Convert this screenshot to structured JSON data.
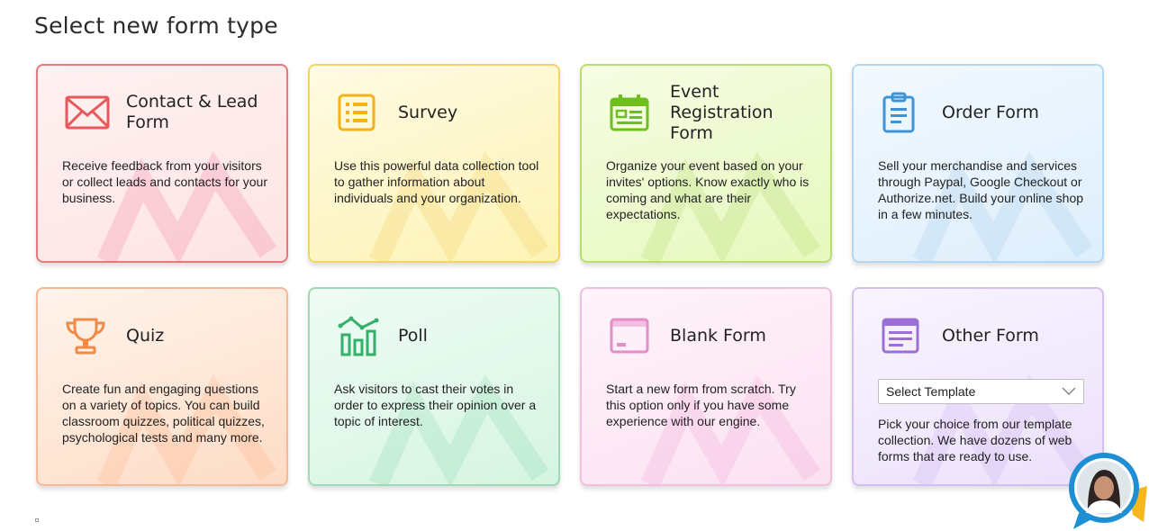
{
  "page": {
    "title": "Select new form type"
  },
  "cards": [
    {
      "title": "Contact & Lead Form",
      "description": "Receive feedback from your visitors or collect leads and contacts for your business.",
      "icon": "envelope-icon",
      "color": "#e8585c"
    },
    {
      "title": "Survey",
      "description": "Use this powerful data collection tool to gather information about individuals and your organization.",
      "icon": "list-icon",
      "color": "#f3b21b"
    },
    {
      "title": "Event Registration Form",
      "description": "Organize your event based on your invites' options. Know exactly who is coming and what are their expectations.",
      "icon": "calendar-icon",
      "color": "#6fbf1c"
    },
    {
      "title": "Order Form",
      "description": "Sell your merchandise and services through Paypal, Google Checkout or Authorize.net. Build your online shop in a few minutes.",
      "icon": "clipboard-icon",
      "color": "#3c93d6"
    },
    {
      "title": "Quiz",
      "description": "Create fun and engaging questions on a variety of topics. You can build classroom quizzes, political quizzes, psychological tests and many more.",
      "icon": "trophy-icon",
      "color": "#f08a44"
    },
    {
      "title": "Poll",
      "description": "Ask visitors to cast their votes in order to express their opinion over a topic of interest.",
      "icon": "bar-chart-icon",
      "color": "#35b06a"
    },
    {
      "title": "Blank Form",
      "description": "Start a new form from scratch. Try this option only if you have some experience with our engine.",
      "icon": "blank-window-icon",
      "color": "#e58ccb"
    },
    {
      "title": "Other Form",
      "description": "Pick your choice from our template collection. We have dozens of web forms that are ready to use.",
      "icon": "template-icon",
      "color": "#9b6fd6",
      "select_value": "Select Template"
    }
  ],
  "chat": {
    "icon": "support-avatar-icon"
  }
}
